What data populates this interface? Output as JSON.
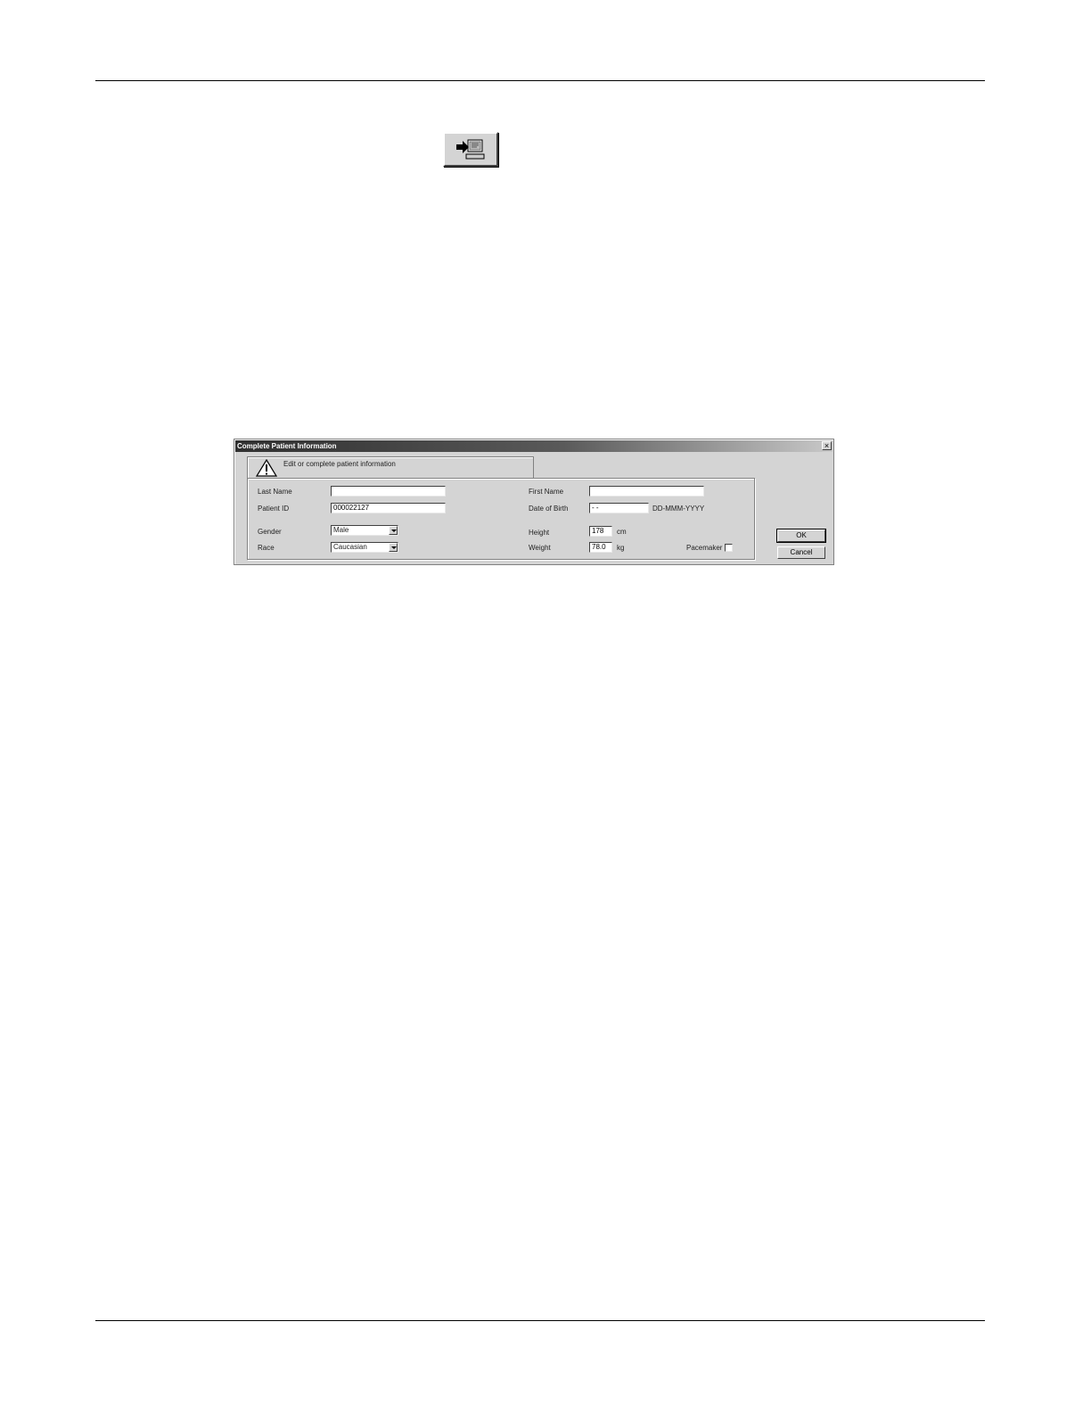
{
  "toolbar_button": {
    "icon": "import-patient-icon"
  },
  "dialog": {
    "title": "Complete Patient Information",
    "close_label": "×",
    "banner": {
      "icon": "warning-icon",
      "text": "Edit or complete patient information"
    },
    "fields": {
      "last_name": {
        "label": "Last Name",
        "value": ""
      },
      "first_name": {
        "label": "First Name",
        "value": ""
      },
      "patient_id": {
        "label": "Patient ID",
        "value": "000022127"
      },
      "date_of_birth": {
        "label": "Date of Birth",
        "value": " -  -",
        "format_hint": "DD-MMM-YYYY"
      },
      "gender": {
        "label": "Gender",
        "value": "Male"
      },
      "race": {
        "label": "Race",
        "value": "Caucasian"
      },
      "height": {
        "label": "Height",
        "value": "178",
        "unit": "cm"
      },
      "weight": {
        "label": "Weight",
        "value": "78.0",
        "unit": "kg"
      },
      "pacemaker": {
        "label": "Pacemaker",
        "checked": false
      }
    },
    "buttons": {
      "ok": "OK",
      "cancel": "Cancel"
    }
  }
}
